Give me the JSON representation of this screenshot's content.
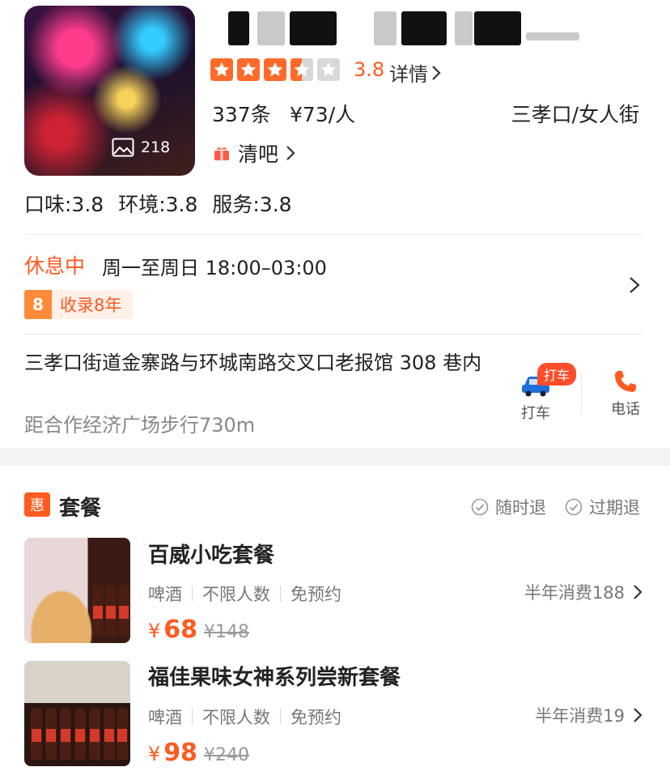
{
  "header": {
    "photo_count": "218",
    "rating_score": "3.8",
    "rating_stars": 3.5,
    "detail_label": "详情",
    "review_count": "337条",
    "price_per_person": "¥73/人",
    "area": "三孝口/女人街",
    "category": "清吧",
    "sub_scores": [
      "口味:3.8",
      "环境:3.8",
      "服务:3.8"
    ]
  },
  "info": {
    "status": "休息中",
    "hours": "周一至周日 18:00–03:00",
    "years_badge_num": "8",
    "years_badge_text": "收录8年",
    "address": "三孝口街道金寨路与环城南路交叉口老报馆 308 巷内",
    "distance": "距合作经济广场步行730m",
    "taxi_badge": "打车",
    "taxi_label": "打车",
    "phone_label": "电话"
  },
  "deals_section": {
    "icon_text": "惠",
    "title": "套餐",
    "policies": [
      "随时退",
      "过期退"
    ],
    "deals": [
      {
        "title": "百威小吃套餐",
        "tags": [
          "啤酒",
          "不限人数",
          "免预约"
        ],
        "sales": "半年消费188",
        "currency": "¥",
        "price": "68",
        "original_price": "¥148"
      },
      {
        "title": "福佳果味女神系列尝新套餐",
        "tags": [
          "啤酒",
          "不限人数",
          "免预约"
        ],
        "sales": "半年消费19",
        "currency": "¥",
        "price": "98",
        "original_price": "¥240"
      }
    ]
  },
  "colors": {
    "accent": "#ff5a1f",
    "star": "#ff6a2a",
    "star_off": "#d8d8d8"
  }
}
